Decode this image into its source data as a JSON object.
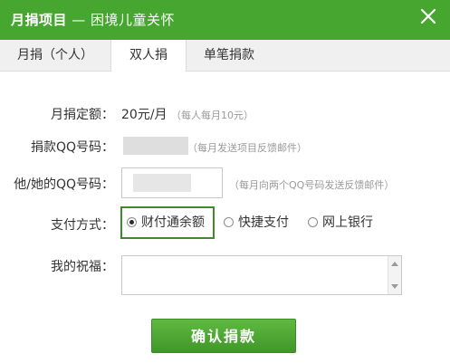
{
  "dialog": {
    "title_main": "月捐项目",
    "title_sub": " — 困境儿童关怀",
    "close_icon": "close-icon"
  },
  "tabs": [
    {
      "label": "月捐（个人）",
      "active": false
    },
    {
      "label": "双人捐",
      "active": true
    },
    {
      "label": "单笔捐款",
      "active": false
    }
  ],
  "form": {
    "amount_label": "月捐定额：",
    "amount_value": "20元/月",
    "amount_hint": "（每人每月10元）",
    "donor_qq_label": "捐款QQ号码：",
    "donor_qq_hint": "（每月发送项目反馈邮件）",
    "partner_qq_label": "他/她的QQ号码：",
    "partner_qq_value": "",
    "partner_qq_hint": "（每月向两个QQ号码发送反馈邮件）",
    "payment_label": "支付方式：",
    "payment_options": [
      {
        "label": "财付通余额",
        "checked": true
      },
      {
        "label": "快捷支付",
        "checked": false
      },
      {
        "label": "网上银行",
        "checked": false
      }
    ],
    "wishes_label": "我的祝福：",
    "wishes_value": ""
  },
  "confirm_button": "确认捐款",
  "colors": {
    "brand_green": "#46a630",
    "highlight_border": "#3e8a2f"
  }
}
